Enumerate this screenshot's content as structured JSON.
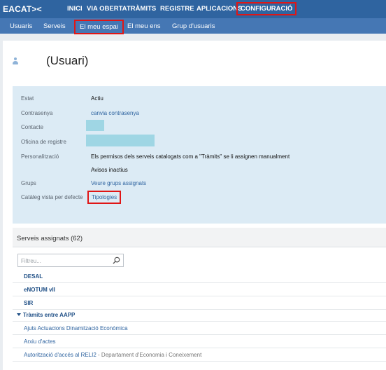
{
  "header": {
    "logo": "EACAT><",
    "nav": [
      "INICI",
      "VIA OBERTA",
      "TRÀMITS",
      "REGISTRE",
      "APLICACIONS",
      "CONFIGURACIÓ"
    ],
    "active": "CONFIGURACIÓ"
  },
  "subnav": {
    "items": [
      "Usuaris",
      "Serveis",
      "El meu espai",
      "El meu ens",
      "Grup d'usuaris"
    ],
    "active": "El meu espai"
  },
  "page": {
    "title": "(Usuari)"
  },
  "info": {
    "estat_label": "Estat",
    "estat_value": "Actiu",
    "contrasenya_label": "Contrasenya",
    "contrasenya_link": "canvia contrasenya",
    "contacte_label": "Contacte",
    "oficina_label": "Oficina de registre",
    "personalitzacio_label": "Personalització",
    "personalitzacio_value": "Els permisos dels serveis catalogats com a \"Tràmits\" se li assignen manualment",
    "avisos_value": "Avisos inactius",
    "grups_label": "Grups",
    "grups_link": "Veure grups assignats",
    "cataleg_label": "Catàleg vista per defecte",
    "cataleg_link": "Tipologies"
  },
  "services": {
    "title": "Serveis assignats (62)",
    "filter_placeholder": "Filtreu...",
    "rows": [
      {
        "text": "DESAL"
      },
      {
        "text": "eNOTUM vII"
      },
      {
        "text": "SIR"
      },
      {
        "text": "Tràmits entre AAPP"
      },
      {
        "text": "Ajuts Actuacions Dinamització Econòmica"
      },
      {
        "text": "Arxiu d'actes"
      },
      {
        "text": "Autorització d'accés al RELI2",
        "dept": " - Departament d'Economia i Coneixement"
      }
    ]
  },
  "colors": {
    "topbar": "#2f64a0",
    "subbar": "#4577b4",
    "highlight": "#e01616",
    "info_bg": "#dcebf5",
    "redacted": "#9fd6e4"
  },
  "icons": [
    "user-icon",
    "search-icon",
    "caret-down-icon"
  ]
}
